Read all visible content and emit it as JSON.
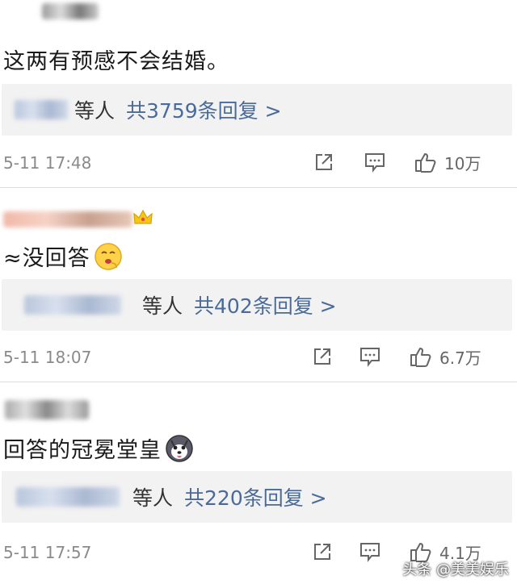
{
  "comments": [
    {
      "text": "这两有预感不会结婚。",
      "reply_suffix": "等人",
      "reply_count": "共3759条回复 >",
      "time": "5-11 17:48",
      "likes": "10万",
      "icons": [
        "share-icon",
        "comment-icon",
        "like-icon"
      ]
    },
    {
      "text": "≈没回答",
      "reply_suffix": "等人",
      "reply_count": "共402条回复 >",
      "time": "5-11 18:07",
      "likes": "6.7万",
      "icons": [
        "share-icon",
        "comment-icon",
        "like-icon"
      ]
    },
    {
      "text": "回答的冠冕堂皇",
      "reply_suffix": "等人",
      "reply_count": "共220条回复 >",
      "time": "5-11 17:57",
      "likes": "4.1万",
      "icons": [
        "share-icon",
        "comment-icon",
        "like-icon"
      ]
    }
  ],
  "watermark": "头条 @美美娱乐",
  "colors": {
    "link": "#4a6a9a",
    "meta": "#8a8a8a",
    "reply_bg": "#f2f2f2"
  }
}
